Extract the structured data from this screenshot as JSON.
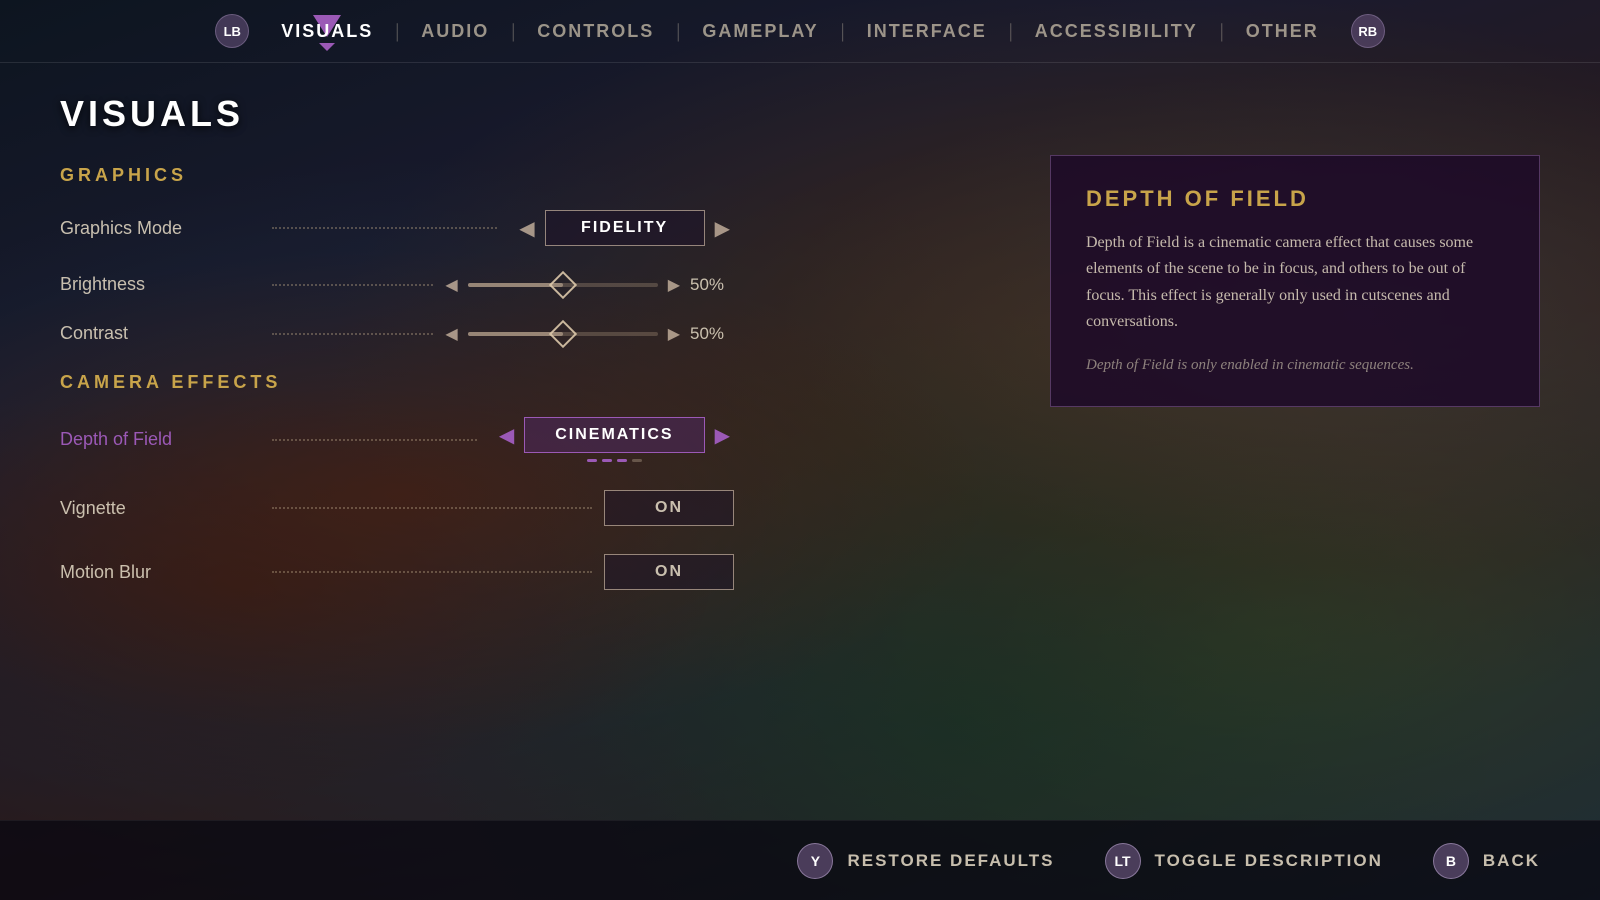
{
  "nav": {
    "lb_label": "LB",
    "rb_label": "RB",
    "tabs": [
      {
        "id": "visuals",
        "label": "VISUALS",
        "active": true
      },
      {
        "id": "audio",
        "label": "AUDIO",
        "active": false
      },
      {
        "id": "controls",
        "label": "CONTROLS",
        "active": false
      },
      {
        "id": "gameplay",
        "label": "GAMEPLAY",
        "active": false
      },
      {
        "id": "interface",
        "label": "INTERFACE",
        "active": false
      },
      {
        "id": "accessibility",
        "label": "ACCESSIBILITY",
        "active": false
      },
      {
        "id": "other",
        "label": "OTHER",
        "active": false
      }
    ]
  },
  "page_title": "VISUALS",
  "sections": {
    "graphics": {
      "header": "GRAPHICS",
      "settings": [
        {
          "id": "graphics_mode",
          "label": "Graphics Mode",
          "type": "selector",
          "value": "FIDELITY",
          "active": false
        },
        {
          "id": "brightness",
          "label": "Brightness",
          "type": "slider",
          "value": 50,
          "display": "50%"
        },
        {
          "id": "contrast",
          "label": "Contrast",
          "type": "slider",
          "value": 50,
          "display": "50%"
        }
      ]
    },
    "camera_effects": {
      "header": "CAMERA EFFECTS",
      "settings": [
        {
          "id": "depth_of_field",
          "label": "Depth of Field",
          "type": "selector",
          "value": "CINEMATICS",
          "active": true
        },
        {
          "id": "vignette",
          "label": "Vignette",
          "type": "toggle",
          "value": "ON"
        },
        {
          "id": "motion_blur",
          "label": "Motion Blur",
          "type": "toggle",
          "value": "ON"
        }
      ]
    }
  },
  "description": {
    "title": "DEPTH OF FIELD",
    "text": "Depth of Field is a cinematic camera effect that causes some elements of the scene to be in focus, and others to be out of focus. This effect is generally only used in cutscenes and conversations.",
    "italic_note": "Depth of Field is only enabled in cinematic sequences."
  },
  "bottom_bar": {
    "restore": {
      "btn_label": "Y",
      "action_label": "RESTORE DEFAULTS"
    },
    "toggle_desc": {
      "btn_label": "LT",
      "action_label": "TOGGLE DESCRIPTION"
    },
    "back": {
      "btn_label": "B",
      "action_label": "BACK"
    }
  }
}
